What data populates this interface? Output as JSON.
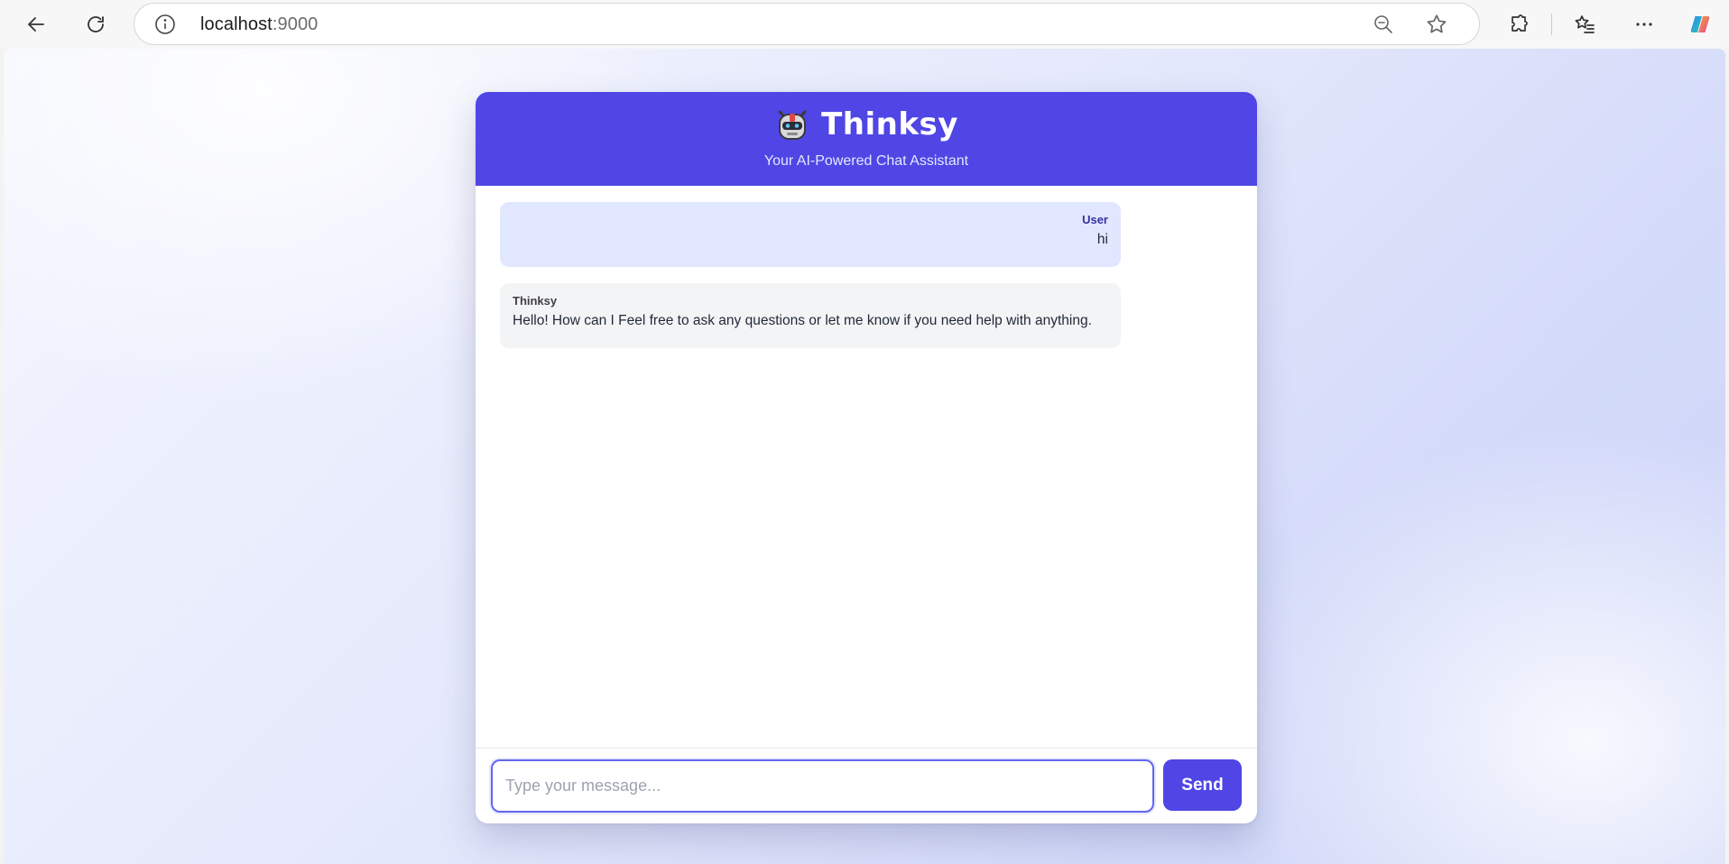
{
  "browser": {
    "url_host": "localhost",
    "url_port": ":9000",
    "icons": {
      "back": "back-arrow-icon",
      "refresh": "refresh-icon",
      "info": "info-icon",
      "zoom": "zoom-out-icon",
      "favorite": "star-icon",
      "extensions": "puzzle-icon",
      "favorites": "favorites-list-icon",
      "more": "more-icon",
      "copilot": "copilot-icon"
    }
  },
  "app": {
    "title": "Thinksy",
    "subtitle": "Your AI-Powered Chat Assistant",
    "logo_icon": "robot-icon",
    "accent_color": "#4f46e5"
  },
  "messages": [
    {
      "sender": "User",
      "text": "hi",
      "role": "user"
    },
    {
      "sender": "Thinksy",
      "text": "Hello! How can I Feel free to ask any questions or let me know if you need help with anything.",
      "role": "assistant"
    }
  ],
  "composer": {
    "placeholder": "Type your message...",
    "value": "",
    "send_label": "Send"
  }
}
